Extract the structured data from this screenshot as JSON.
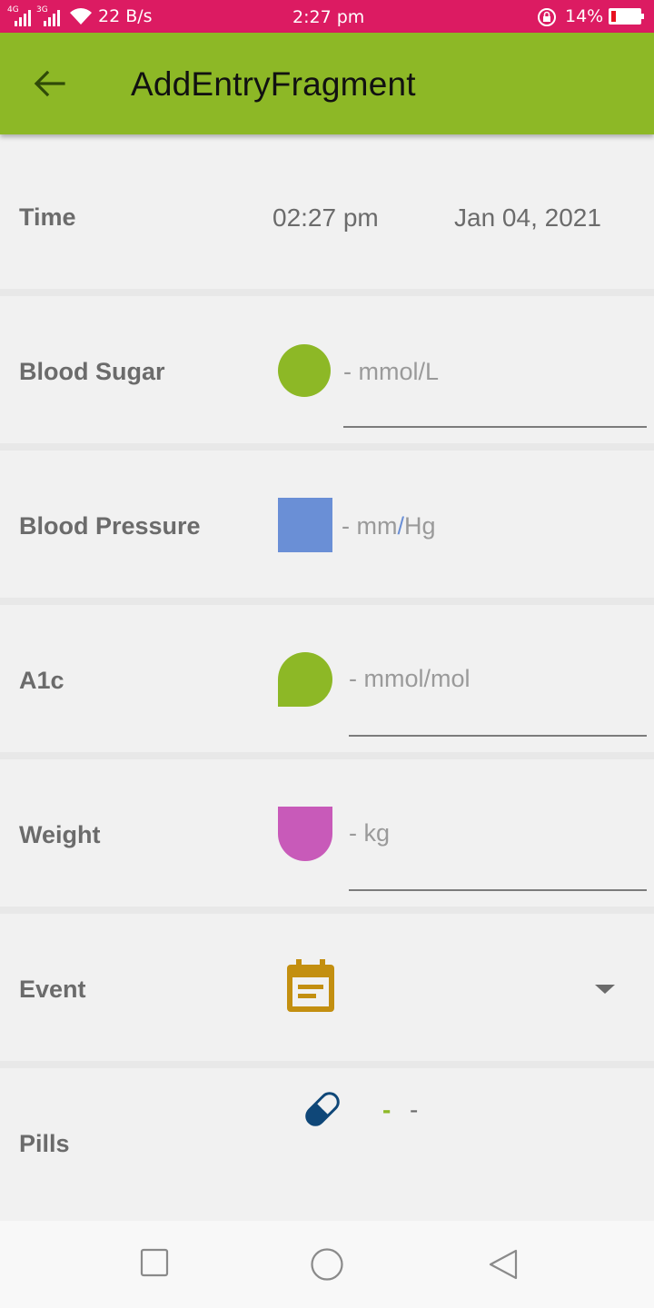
{
  "status_bar": {
    "network_1": "4G",
    "network_2": "3G",
    "speed": "22 B/s",
    "time": "2:27 pm",
    "battery": "14%",
    "battery_level": 0.14
  },
  "app_bar": {
    "title": "AddEntryFragment",
    "color": "#8db826"
  },
  "time_row": {
    "label": "Time",
    "time": "02:27 pm",
    "date": "Jan 04, 2021"
  },
  "blood_sugar": {
    "label": "Blood Sugar",
    "placeholder": "- mmol/L",
    "icon": "circle-icon",
    "color": "#8db826"
  },
  "blood_pressure": {
    "label": "Blood Pressure",
    "dash": "- mm",
    "slash": "/",
    "unit": "Hg",
    "icon": "square-icon",
    "color": "#6a8fd6"
  },
  "a1c": {
    "label": "A1c",
    "placeholder": "- mmol/mol",
    "icon": "leaf-icon",
    "color": "#8db826"
  },
  "weight": {
    "label": "Weight",
    "placeholder": "- kg",
    "icon": "cup-icon",
    "color": "#c85ab9"
  },
  "event": {
    "label": "Event",
    "icon": "calendar-event-icon",
    "color": "#c38f10"
  },
  "pills": {
    "label": "Pills",
    "icon": "pill-icon",
    "color": "#0f4778",
    "dash_green": "-",
    "dash_gray": "-"
  }
}
